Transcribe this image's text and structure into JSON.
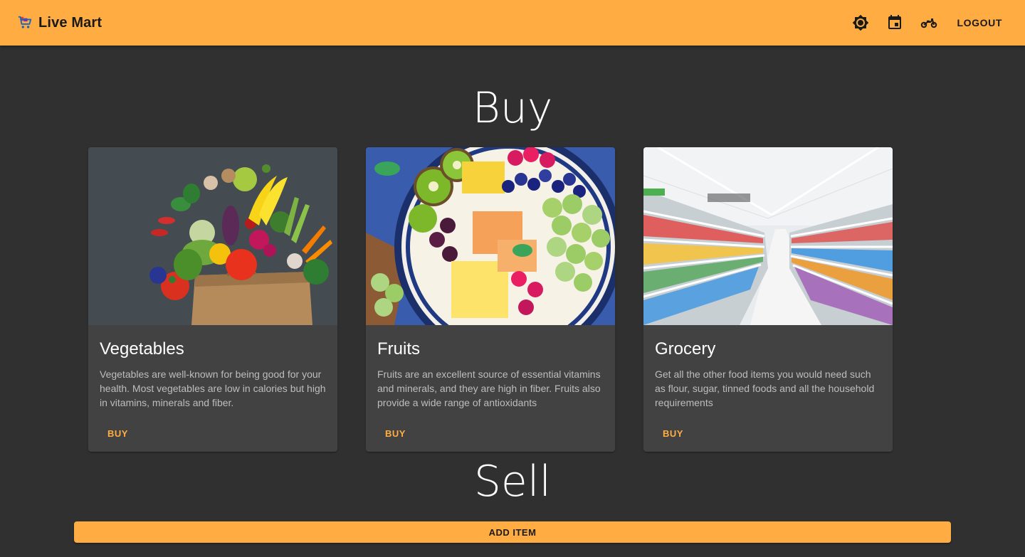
{
  "app": {
    "title": "Live Mart",
    "logo_icon": "shopping-cart-icon"
  },
  "header": {
    "actions": [
      {
        "icon": "brightness-icon"
      },
      {
        "icon": "calendar-event-icon"
      },
      {
        "icon": "motorcycle-icon"
      }
    ],
    "logout_label": "LOGOUT"
  },
  "colors": {
    "accent": "#ffad42",
    "background": "#303030",
    "card": "#424242",
    "card_text": "#bdbdbd"
  },
  "buy": {
    "title": "Buy",
    "cards": [
      {
        "title": "Vegetables",
        "description": "Vegetables are well-known for being good for your health. Most vegetables are low in calories but high in vitamins, minerals and fiber.",
        "action_label": "BUY",
        "image": "vegetables-image"
      },
      {
        "title": "Fruits",
        "description": "Fruits are an excellent source of essential vitamins and minerals, and they are high in fiber. Fruits also provide a wide range of antioxidants",
        "action_label": "BUY",
        "image": "fruits-image"
      },
      {
        "title": "Grocery",
        "description": "Get all the other food items you would need such as flour, sugar, tinned foods and all the household requirements",
        "action_label": "BUY",
        "image": "grocery-aisle-image"
      }
    ]
  },
  "sell": {
    "title": "Sell",
    "add_item_label": "ADD ITEM"
  }
}
